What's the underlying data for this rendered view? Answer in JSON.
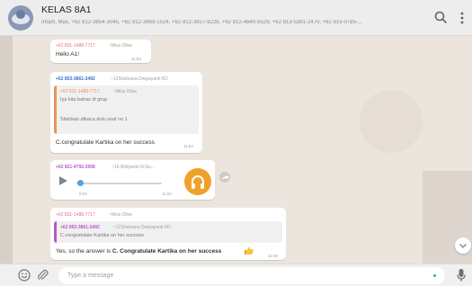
{
  "header": {
    "title": "KELAS 8A1",
    "members": "Irham, Mas, +62 812-3854-3045, +62 812-3869-1524, +62 812-3927-9228, +62 812-4640-8529, +62 813-5391-2470, +62 819-0785-..."
  },
  "messages": [
    {
      "sender_phone": "+62 831-1488-7717",
      "sender_name": "~Miss Olive",
      "text": "Hello A1!",
      "time": "11:54"
    },
    {
      "sender_phone": "+62 853-3861-3492",
      "sender_name": "~12Sheleana Dwipayanti KD",
      "quote": {
        "phone": "+62 831-1488-7717",
        "name": "~Miss Olive",
        "line1": "Iya kita bahas di grup",
        "line2": "Silahkan dibaca dulu soal no 1"
      },
      "text": "C.congratulate Kartika on her success",
      "time": "11:54"
    },
    {
      "sender_phone": "+62 821-4792-2008",
      "sender_name": "~16.Widyantri N Gu...",
      "voice_elapsed": "0:04",
      "time": "11:54"
    },
    {
      "sender_phone": "+62 831-1488-7717",
      "sender_name": "~Miss Olive",
      "quote": {
        "phone": "+62 853-3861-3492",
        "name": "~12Sheleana Dwipayanti KD",
        "line1": "C.congratulate Kartika on her success"
      },
      "text_prefix": "Yes, so the answer is ",
      "text_bold": "C. Congratulate Kartika on her success",
      "time": "11:55"
    }
  ],
  "composer": {
    "placeholder": "Type a message"
  },
  "colors": {
    "accent_orange": "#f0a12a",
    "sender_blue": "#3b6bd1",
    "sender_purple": "#b05bc7",
    "sender_pink": "#e56a98",
    "sender_orange": "#e89457",
    "voice_blue": "#4fa3e8"
  },
  "icons": [
    "group-avatar",
    "search-icon",
    "menu-dots-icon",
    "play-icon",
    "headphones-icon",
    "forward-icon",
    "chevron-down-icon",
    "emoji-icon",
    "attach-icon",
    "mic-icon",
    "thumbs-up-emoji"
  ]
}
